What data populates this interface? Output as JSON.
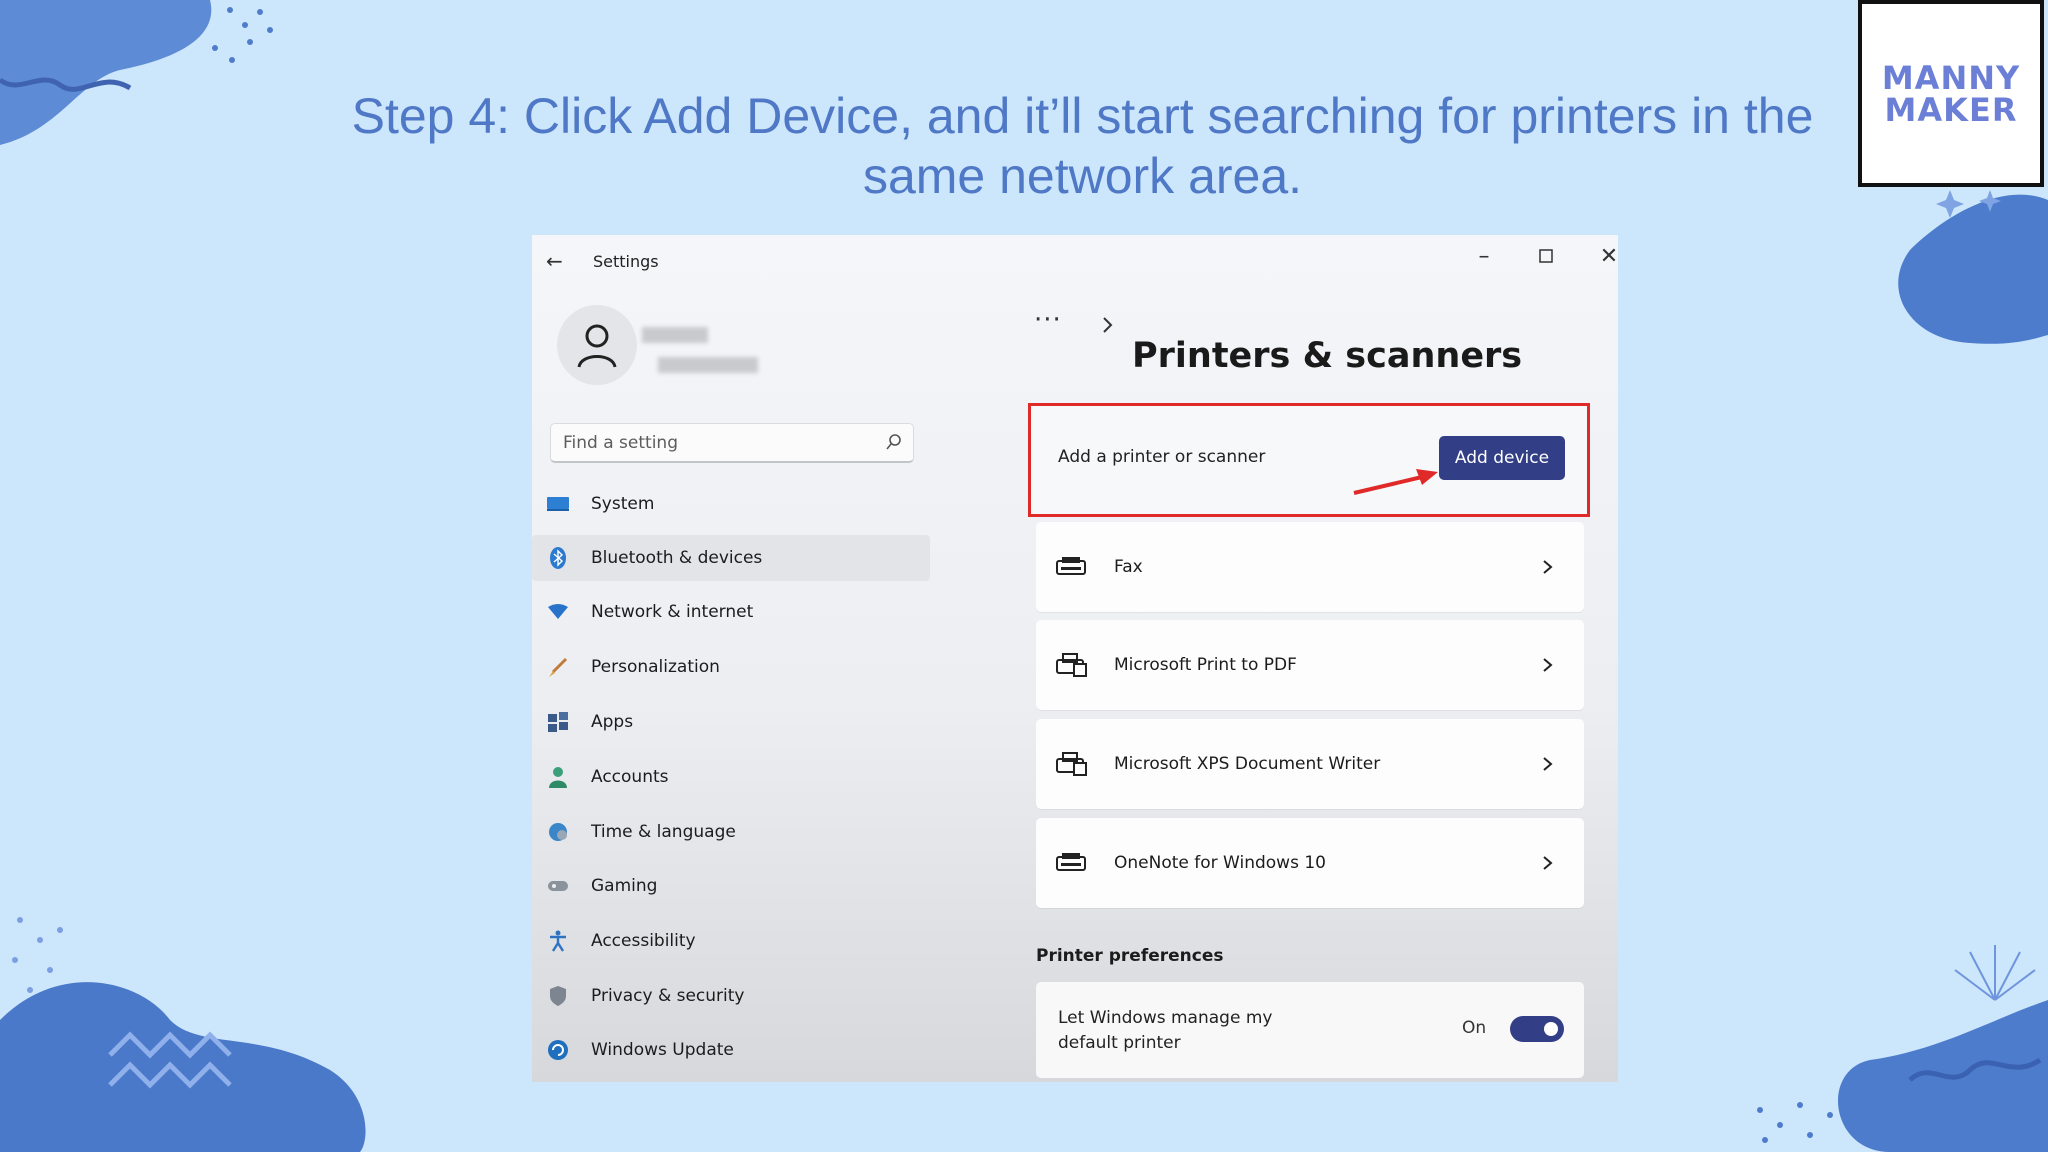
{
  "slide": {
    "heading": "Step 4: Click Add Device, and it’ll start searching for printers in the same network area.",
    "logo_line1": "MANNY",
    "logo_line2": "MAKER",
    "accent_color": "#4f78c6",
    "background_color": "#cce6fb"
  },
  "window": {
    "title": "Settings",
    "back_icon": "back-arrow-icon",
    "controls": [
      "minimize-icon",
      "maximize-icon",
      "close-icon"
    ]
  },
  "sidebar": {
    "search_placeholder": "Find a setting",
    "items": [
      {
        "label": "System",
        "icon": "system-icon"
      },
      {
        "label": "Bluetooth & devices",
        "icon": "bluetooth-icon",
        "selected": true
      },
      {
        "label": "Network & internet",
        "icon": "wifi-icon"
      },
      {
        "label": "Personalization",
        "icon": "brush-icon"
      },
      {
        "label": "Apps",
        "icon": "apps-icon"
      },
      {
        "label": "Accounts",
        "icon": "accounts-icon"
      },
      {
        "label": "Time & language",
        "icon": "globe-clock-icon"
      },
      {
        "label": "Gaming",
        "icon": "gamepad-icon"
      },
      {
        "label": "Accessibility",
        "icon": "accessibility-icon"
      },
      {
        "label": "Privacy & security",
        "icon": "shield-icon"
      },
      {
        "label": "Windows Update",
        "icon": "update-icon"
      }
    ]
  },
  "main": {
    "breadcrumb_more": "···",
    "title": "Printers & scanners",
    "add_label": "Add a printer or scanner",
    "add_button": "Add device",
    "printers": [
      {
        "label": "Fax",
        "icon": "fax-icon"
      },
      {
        "label": "Microsoft Print to PDF",
        "icon": "printer-icon"
      },
      {
        "label": "Microsoft XPS Document Writer",
        "icon": "printer-icon"
      },
      {
        "label": "OneNote for Windows 10",
        "icon": "printer-icon"
      }
    ],
    "preferences_heading": "Printer preferences",
    "pref_label": "Let Windows manage my default printer",
    "pref_state": "On",
    "toggle_on": true,
    "highlight_color": "#e02a2a",
    "button_color": "#323f86"
  }
}
